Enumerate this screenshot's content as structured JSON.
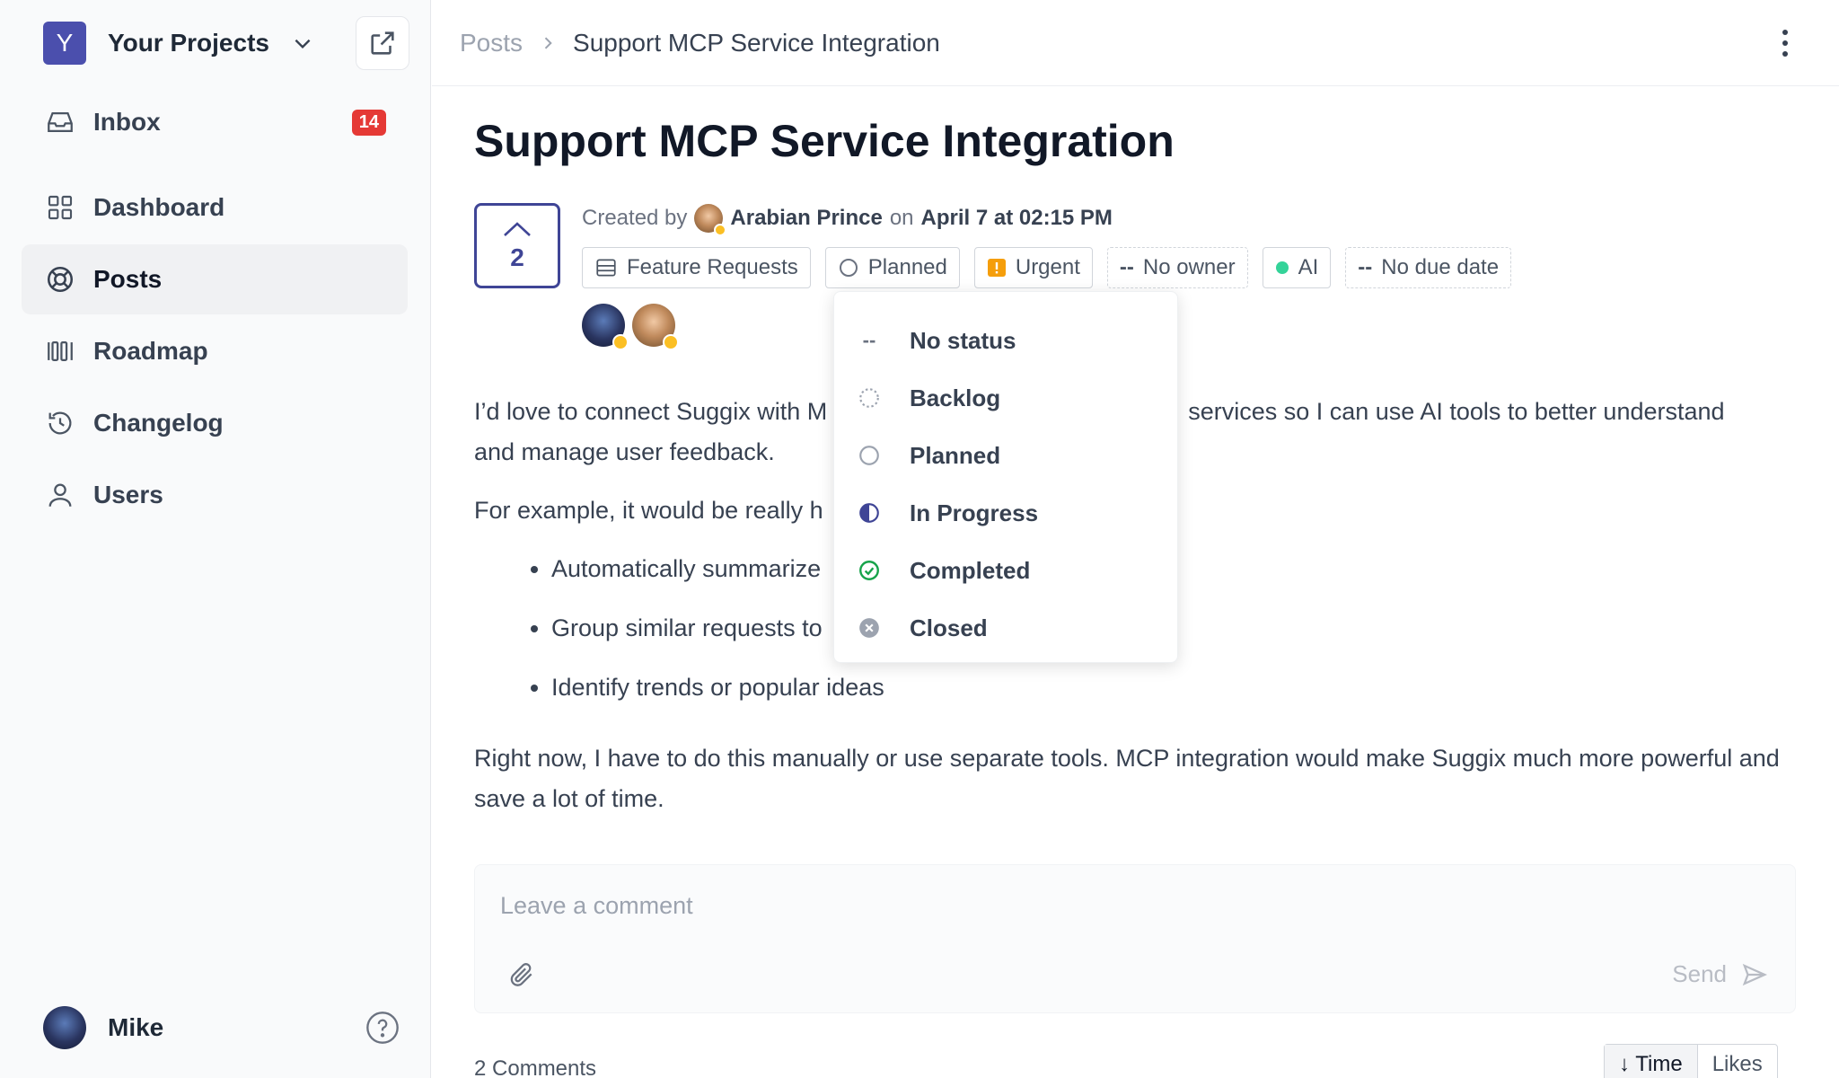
{
  "sidebar": {
    "project_initial": "Y",
    "project_name": "Your Projects",
    "items": [
      {
        "label": "Inbox",
        "icon": "inbox-icon",
        "badge": "14"
      },
      {
        "label": "Dashboard",
        "icon": "dashboard-icon"
      },
      {
        "label": "Posts",
        "icon": "lifebuoy-icon",
        "active": true
      },
      {
        "label": "Roadmap",
        "icon": "roadmap-icon"
      },
      {
        "label": "Changelog",
        "icon": "history-icon"
      },
      {
        "label": "Users",
        "icon": "user-icon"
      }
    ],
    "user_name": "Mike"
  },
  "breadcrumb": {
    "parent": "Posts",
    "current": "Support MCP Service Integration"
  },
  "post": {
    "title": "Support MCP Service Integration",
    "votes": "2",
    "created_by_label": "Created by",
    "author": "Arabian Prince",
    "on_label": "on",
    "date": "April 7 at 02:15 PM",
    "chips": {
      "board": "Feature Requests",
      "status": "Planned",
      "priority": "Urgent",
      "owner": "No owner",
      "tag": "AI",
      "due": "No due date",
      "dash": "--"
    },
    "paragraph1": "I’d love to connect Suggix with M",
    "paragraph1b": "services so I can use AI tools to better understand",
    "paragraph1c": "and manage user feedback.",
    "paragraph2": "For example, it would be really h",
    "bullets": [
      "Automatically summarize",
      "Group similar requests to",
      "Identify trends or popular ideas"
    ],
    "paragraph3": "Right now, I have to do this manually or use separate tools. MCP integration would make Suggix much more powerful and save a lot of time."
  },
  "status_menu": {
    "items": [
      {
        "label": "No status",
        "glyph": "--"
      },
      {
        "label": "Backlog"
      },
      {
        "label": "Planned"
      },
      {
        "label": "In Progress"
      },
      {
        "label": "Completed"
      },
      {
        "label": "Closed"
      }
    ]
  },
  "comment": {
    "placeholder": "Leave a comment",
    "send_label": "Send",
    "count_label": "2 Comments",
    "sort_time": "↓ Time",
    "sort_likes": "Likes"
  },
  "colors": {
    "accent": "#3f4596",
    "badge": "#e53935",
    "urgent": "#f59e0b",
    "ai_dot": "#34d399",
    "completed": "#16a34a"
  }
}
